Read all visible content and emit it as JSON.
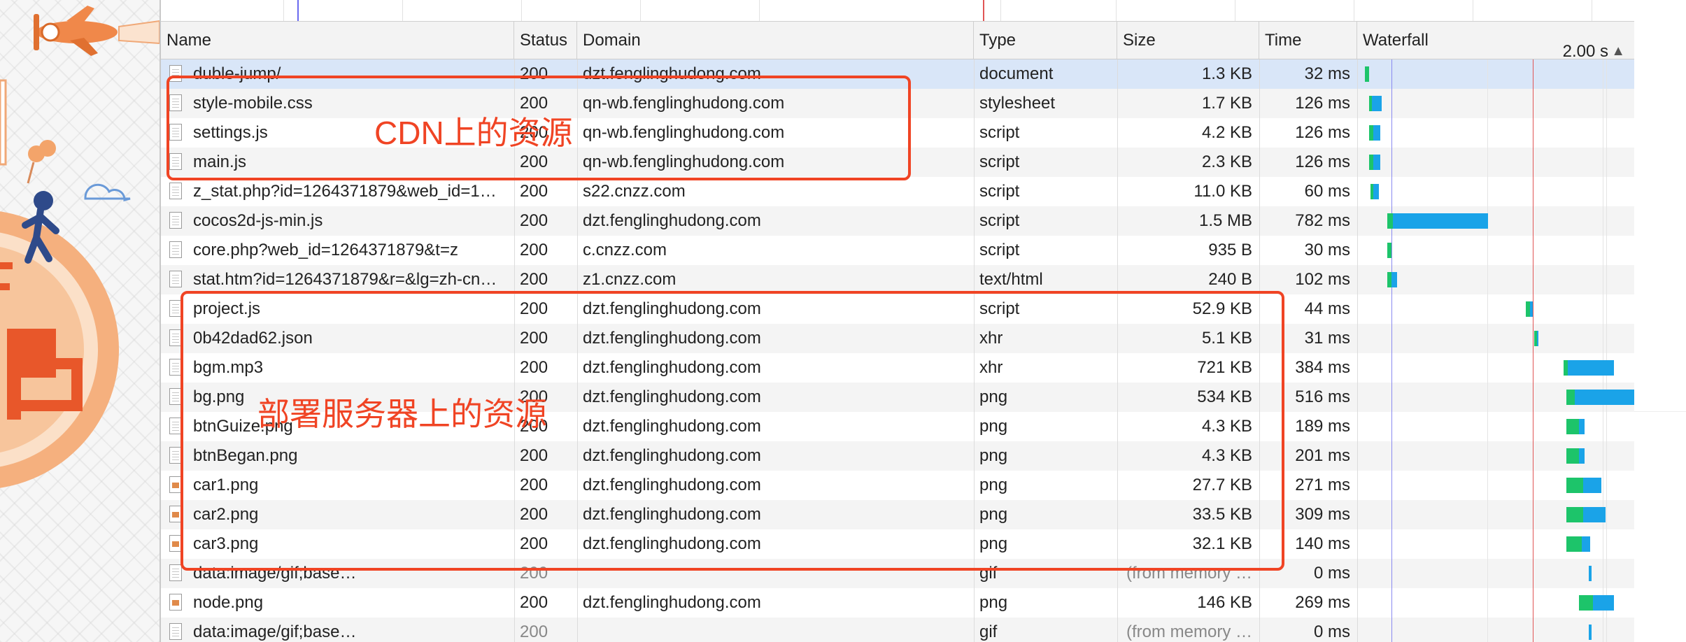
{
  "columns": {
    "name": "Name",
    "status": "Status",
    "domain": "Domain",
    "type": "Type",
    "size": "Size",
    "time": "Time",
    "waterfall": "Waterfall",
    "waterfall_sort_label": "2.00 s",
    "sort_icon": "triangle-up-icon"
  },
  "rows": [
    {
      "name": "duble-jump/",
      "status": "200",
      "domain": "dzt.fenglinghudong.com",
      "type": "document",
      "size": "1.3 KB",
      "time": "32 ms",
      "icon": "document"
    },
    {
      "name": "style-mobile.css",
      "status": "200",
      "domain": "qn-wb.fenglinghudong.com",
      "type": "stylesheet",
      "size": "1.7 KB",
      "time": "126 ms",
      "icon": "document"
    },
    {
      "name": "settings.js",
      "status": "200",
      "domain": "qn-wb.fenglinghudong.com",
      "type": "script",
      "size": "4.2 KB",
      "time": "126 ms",
      "icon": "document"
    },
    {
      "name": "main.js",
      "status": "200",
      "domain": "qn-wb.fenglinghudong.com",
      "type": "script",
      "size": "2.3 KB",
      "time": "126 ms",
      "icon": "document"
    },
    {
      "name": "z_stat.php?id=1264371879&web_id=1…",
      "status": "200",
      "domain": "s22.cnzz.com",
      "type": "script",
      "size": "11.0 KB",
      "time": "60 ms",
      "icon": "document"
    },
    {
      "name": "cocos2d-js-min.js",
      "status": "200",
      "domain": "dzt.fenglinghudong.com",
      "type": "script",
      "size": "1.5 MB",
      "time": "782 ms",
      "icon": "document"
    },
    {
      "name": "core.php?web_id=1264371879&t=z",
      "status": "200",
      "domain": "c.cnzz.com",
      "type": "script",
      "size": "935 B",
      "time": "30 ms",
      "icon": "document"
    },
    {
      "name": "stat.htm?id=1264371879&r=&lg=zh-cn…",
      "status": "200",
      "domain": "z1.cnzz.com",
      "type": "text/html",
      "size": "240 B",
      "time": "102 ms",
      "icon": "blank"
    },
    {
      "name": "project.js",
      "status": "200",
      "domain": "dzt.fenglinghudong.com",
      "type": "script",
      "size": "52.9 KB",
      "time": "44 ms",
      "icon": "document"
    },
    {
      "name": "0b42dad62.json",
      "status": "200",
      "domain": "dzt.fenglinghudong.com",
      "type": "xhr",
      "size": "5.1 KB",
      "time": "31 ms",
      "icon": "blank"
    },
    {
      "name": "bgm.mp3",
      "status": "200",
      "domain": "dzt.fenglinghudong.com",
      "type": "xhr",
      "size": "721 KB",
      "time": "384 ms",
      "icon": "blank"
    },
    {
      "name": "bg.png",
      "status": "200",
      "domain": "dzt.fenglinghudong.com",
      "type": "png",
      "size": "534 KB",
      "time": "516 ms",
      "icon": "blank"
    },
    {
      "name": "btnGuize.png",
      "status": "200",
      "domain": "dzt.fenglinghudong.com",
      "type": "png",
      "size": "4.3 KB",
      "time": "189 ms",
      "icon": "blank"
    },
    {
      "name": "btnBegan.png",
      "status": "200",
      "domain": "dzt.fenglinghudong.com",
      "type": "png",
      "size": "4.3 KB",
      "time": "201 ms",
      "icon": "blank"
    },
    {
      "name": "car1.png",
      "status": "200",
      "domain": "dzt.fenglinghudong.com",
      "type": "png",
      "size": "27.7 KB",
      "time": "271 ms",
      "icon": "image"
    },
    {
      "name": "car2.png",
      "status": "200",
      "domain": "dzt.fenglinghudong.com",
      "type": "png",
      "size": "33.5 KB",
      "time": "309 ms",
      "icon": "image"
    },
    {
      "name": "car3.png",
      "status": "200",
      "domain": "dzt.fenglinghudong.com",
      "type": "png",
      "size": "32.1 KB",
      "time": "140 ms",
      "icon": "image"
    },
    {
      "name": "data:image/gif;base…",
      "status": "200",
      "domain": "",
      "type": "gif",
      "size": "(from memory …",
      "time": "0 ms",
      "icon": "blank",
      "dim": true
    },
    {
      "name": "node.png",
      "status": "200",
      "domain": "dzt.fenglinghudong.com",
      "type": "png",
      "size": "146 KB",
      "time": "269 ms",
      "icon": "image"
    },
    {
      "name": "data:image/gif;base…",
      "status": "200",
      "domain": "",
      "type": "gif",
      "size": "(from memory …",
      "time": "0 ms",
      "icon": "blank",
      "dim": true
    }
  ],
  "annotations": {
    "cdn_label": "CDN上的资源",
    "server_label": "部署服务器上的资源",
    "color": "#f04424"
  },
  "colors": {
    "selected_row": "#d9e6f8",
    "bar_download": "#1aa3e8",
    "bar_waiting": "#1dc46a",
    "dom_content_loaded_line": "#6a6af0",
    "load_line": "#e05555"
  }
}
